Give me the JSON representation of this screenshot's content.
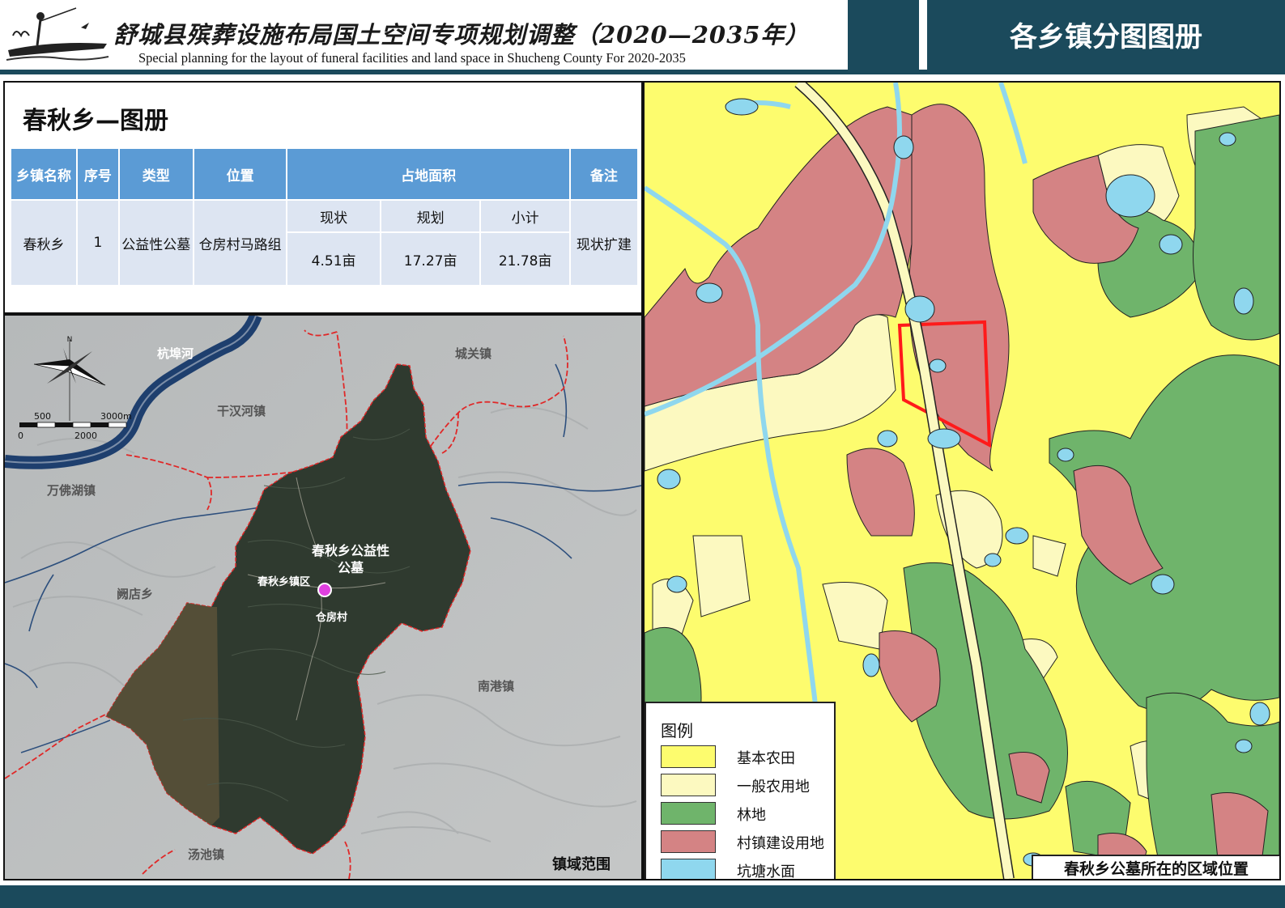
{
  "header": {
    "title_cn": "舒城县殡葬设施布局国土空间专项规划调整（2020—2035年）",
    "title_en": "Special planning for the layout of funeral facilities and land space in Shucheng County For 2020-2035",
    "atlas_title": "各乡镇分图图册"
  },
  "panel": {
    "title": "春秋乡—图册",
    "table": {
      "headers": {
        "town": "乡镇名称",
        "seq": "序号",
        "type": "类型",
        "location": "位置",
        "area": "占地面积",
        "note": "备注"
      },
      "subheaders": {
        "current": "现状",
        "planned": "规划",
        "subtotal": "小计"
      },
      "row": {
        "town": "春秋乡",
        "seq": "1",
        "type": "公益性公墓",
        "location": "仓房村马路组",
        "current": "4.51亩",
        "planned": "17.27亩",
        "subtotal": "21.78亩",
        "note": "现状扩建"
      }
    }
  },
  "overview_map": {
    "north_label": "N",
    "scale_top": [
      "500",
      "3000m"
    ],
    "scale_bottom": [
      "0",
      "2000"
    ],
    "river_label": "杭埠河",
    "towns": {
      "chengguan": "城关镇",
      "ganwanhe": "干汉河镇",
      "wanfohu": "万佛湖镇",
      "quedian": "阙店乡",
      "nangang": "南港镇",
      "tangchi": "汤池镇"
    },
    "cemetery_label": "春秋乡公益性公墓",
    "town_center_label": "春秋乡镇区",
    "village_label": "仓房村",
    "caption": "镇域范围",
    "colors": {
      "boundary": "#e03030",
      "river": "#1e3f6e",
      "marker": "#e040e0"
    }
  },
  "detail_map": {
    "legend": {
      "title": "图例",
      "items": [
        {
          "label": "基本农田",
          "color": "#fdfc6e"
        },
        {
          "label": "一般农用地",
          "color": "#fcf9c0"
        },
        {
          "label": "林地",
          "color": "#6fb46b"
        },
        {
          "label": "村镇建设用地",
          "color": "#d48384"
        },
        {
          "label": "坑塘水面",
          "color": "#8fd7ee"
        }
      ]
    },
    "caption": "春秋乡公墓所在的区域位置",
    "highlight_color": "#ff1a1a"
  }
}
